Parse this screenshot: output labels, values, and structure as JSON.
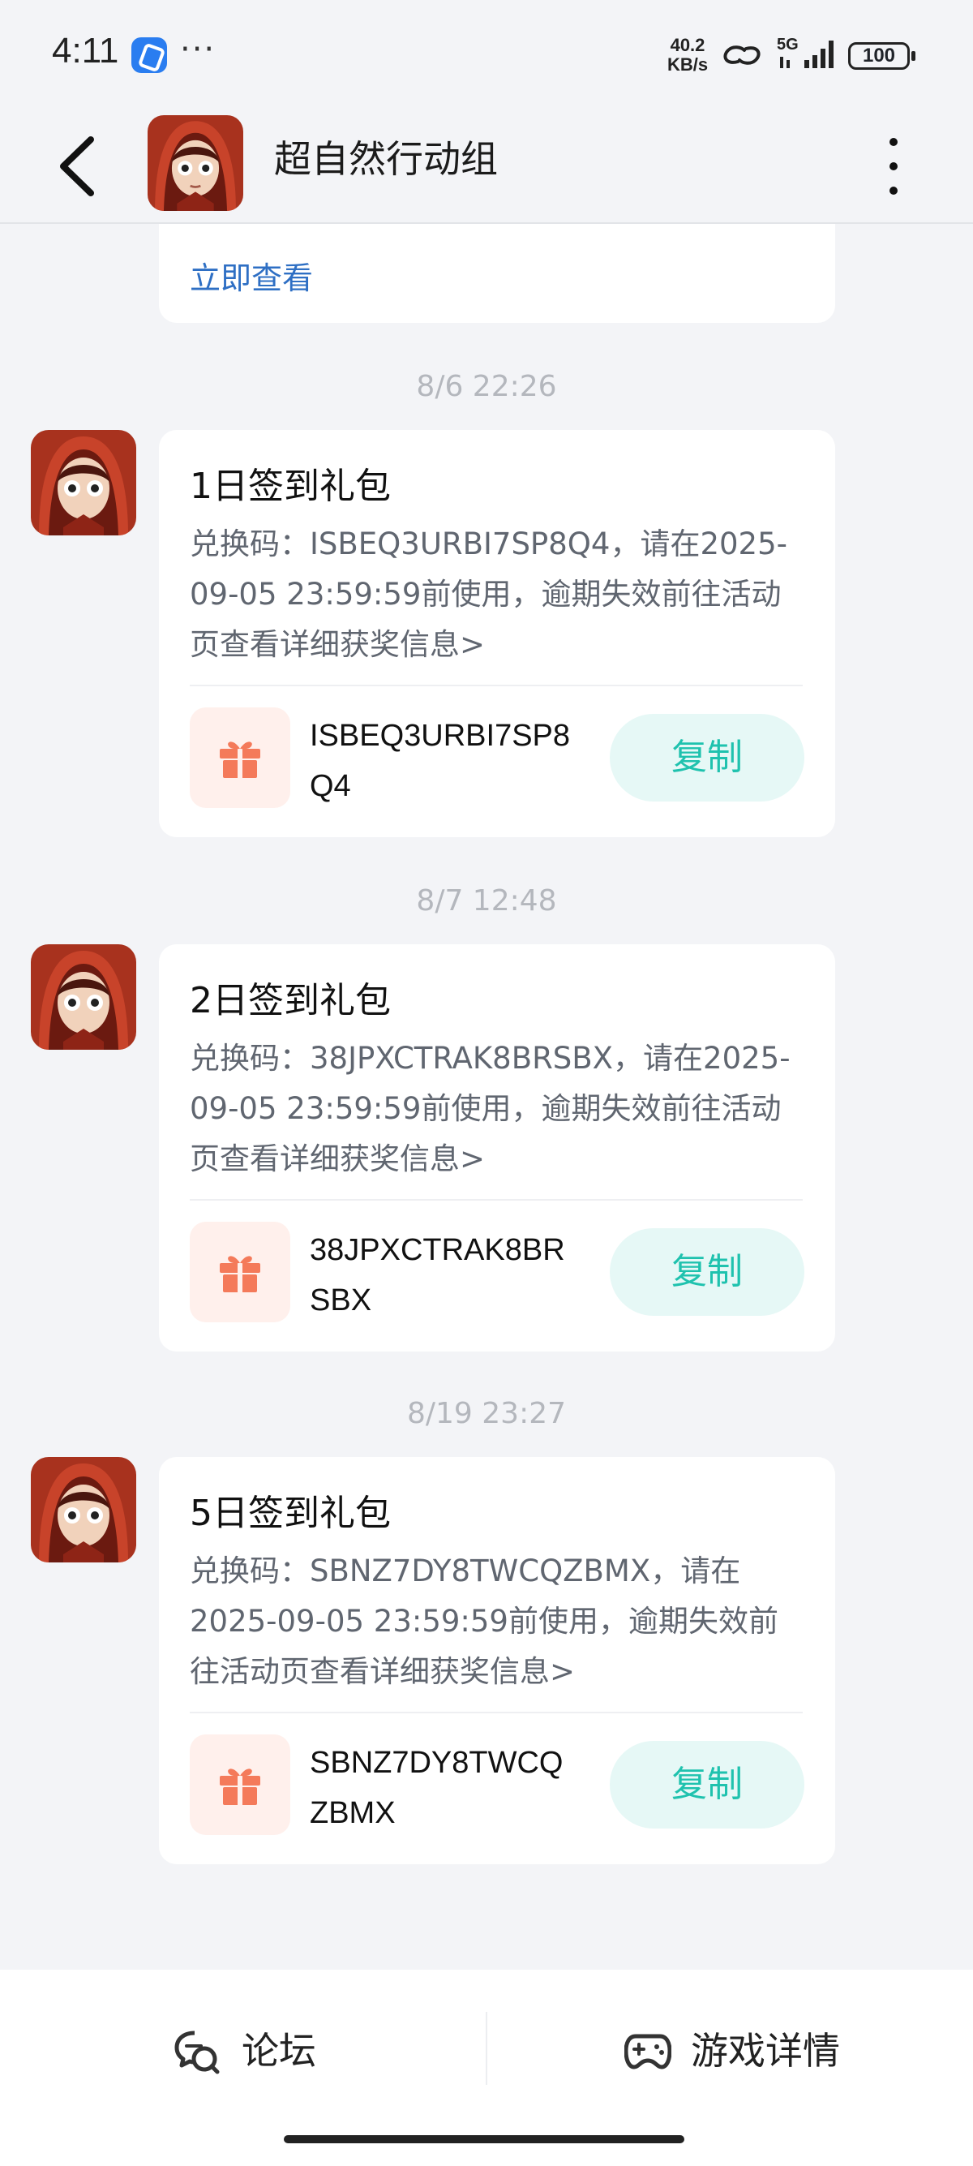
{
  "status_bar": {
    "time": "4:11",
    "dots": "···",
    "net_speed_value": "40.2",
    "net_speed_unit": "KB/s",
    "signal_label": "5G",
    "battery": "100"
  },
  "header": {
    "title": "超自然行动组",
    "avatar_icon": "game-avatar-icon",
    "back_icon": "chevron-left-icon",
    "more_icon": "more-vertical-icon"
  },
  "top_card": {
    "link": "立即查看"
  },
  "messages": [
    {
      "timestamp": "8/6  22:26",
      "title": "1日签到礼包",
      "body": "兑换码：ISBEQ3URBI7SP8Q4，请在2025-09-05 23:59:59前使用，逾期失效前往活动页查看详细获奖信息>",
      "code": "ISBEQ3URBI7SP8Q4",
      "copy_label": "复制"
    },
    {
      "timestamp": "8/7  12:48",
      "title": "2日签到礼包",
      "body": "兑换码：38JPXCTRAK8BRSBX，请在2025-09-05 23:59:59前使用，逾期失效前往活动页查看详细获奖信息>",
      "code": "38JPXCTRAK8BRSBX",
      "copy_label": "复制"
    },
    {
      "timestamp": "8/19  23:27",
      "title": "5日签到礼包",
      "body": "兑换码：SBNZ7DY8TWCQZBMX，请在2025-09-05 23:59:59前使用，逾期失效前往活动页查看详细获奖信息>",
      "code": "SBNZ7DY8TWCQZBMX",
      "copy_label": "复制"
    }
  ],
  "bottom_bar": {
    "forum_label": "论坛",
    "forum_icon": "forum-chat-icon",
    "details_label": "游戏详情",
    "details_icon": "gamepad-icon"
  },
  "colors": {
    "accent": "#1fc2ae",
    "link": "#2e6fc4",
    "gift": "#f47a5a",
    "background": "#f3f4f7"
  }
}
